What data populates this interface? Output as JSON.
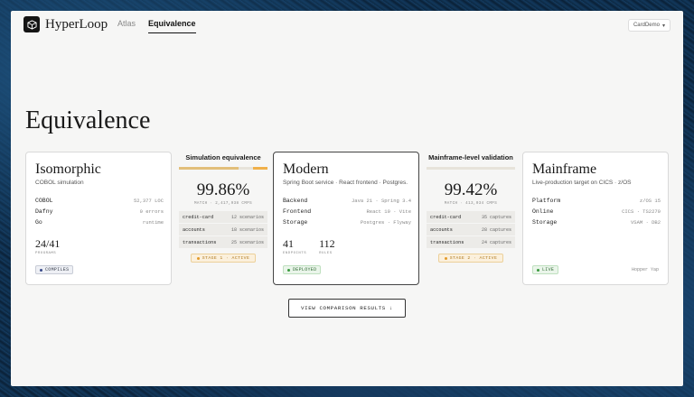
{
  "app": {
    "brand": "HyperLoop",
    "project": "CardDemo"
  },
  "nav": [
    {
      "label": "Atlas",
      "active": false
    },
    {
      "label": "Equivalence",
      "active": true
    }
  ],
  "page_title": "Equivalence",
  "cards": {
    "isomorphic": {
      "title": "Isomorphic",
      "subtitle": "COBOL simulation",
      "rows": [
        {
          "k": "COBOL",
          "v": "52,377 LOC"
        },
        {
          "k": "Dafny",
          "v": "0 errors"
        },
        {
          "k": "Go",
          "v": "runtime"
        }
      ],
      "stats": [
        {
          "num": "24/41",
          "label": "PROGRAMS"
        }
      ],
      "badge": "COMPILES"
    },
    "modern": {
      "title": "Modern",
      "subtitle": "Spring Boot service · React frontend · Postgres.",
      "rows": [
        {
          "k": "Backend",
          "v": "Java 21 · Spring 3.4"
        },
        {
          "k": "Frontend",
          "v": "React 19 · Vite"
        },
        {
          "k": "Storage",
          "v": "Postgres · Flyway"
        }
      ],
      "stats": [
        {
          "num": "41",
          "label": "ENDPOINTS"
        },
        {
          "num": "112",
          "label": "RULES"
        }
      ],
      "badge": "DEPLOYED"
    },
    "mainframe": {
      "title": "Mainframe",
      "subtitle": "Live-production target on CICS · z/OS",
      "rows": [
        {
          "k": "Platform",
          "v": "z/OS 15"
        },
        {
          "k": "Online",
          "v": "CICS · TS2270"
        },
        {
          "k": "Storage",
          "v": "VSAM · DB2"
        }
      ],
      "badge": "LIVE",
      "footnote": "Hopper Yap"
    }
  },
  "bridges": {
    "simulation": {
      "title": "Simulation equivalence",
      "progress": 0.8,
      "pct": "99.86%",
      "match_label": "MATCH · 2,417,938 CMPS",
      "scenarios": [
        {
          "name": "credit-card",
          "count": "12 scenarios"
        },
        {
          "name": "accounts",
          "count": "18 scenarios"
        },
        {
          "name": "transactions",
          "count": "25 scenarios"
        }
      ],
      "stage": "STAGE 1 · ACTIVE"
    },
    "mainframe": {
      "title": "Mainframe-level validation",
      "progress": 0.0,
      "pct": "99.42%",
      "match_label": "MATCH · 413,034 CMPS",
      "scenarios": [
        {
          "name": "credit-card",
          "count": "35 captures"
        },
        {
          "name": "accounts",
          "count": "28 captures"
        },
        {
          "name": "transactions",
          "count": "24 captures"
        }
      ],
      "stage": "STAGE 2 · ACTIVE"
    }
  },
  "cta": {
    "label": "VIEW COMPARISON RESULTS",
    "arrow": "↓"
  },
  "colors": {
    "accent": "#f0b04a",
    "live": "#3a9a3e",
    "compiles": "#3a4a8a"
  },
  "icons": {
    "logo": "cube-icon",
    "dropdown": "chevron-down-icon",
    "cta": "arrow-down-icon"
  }
}
